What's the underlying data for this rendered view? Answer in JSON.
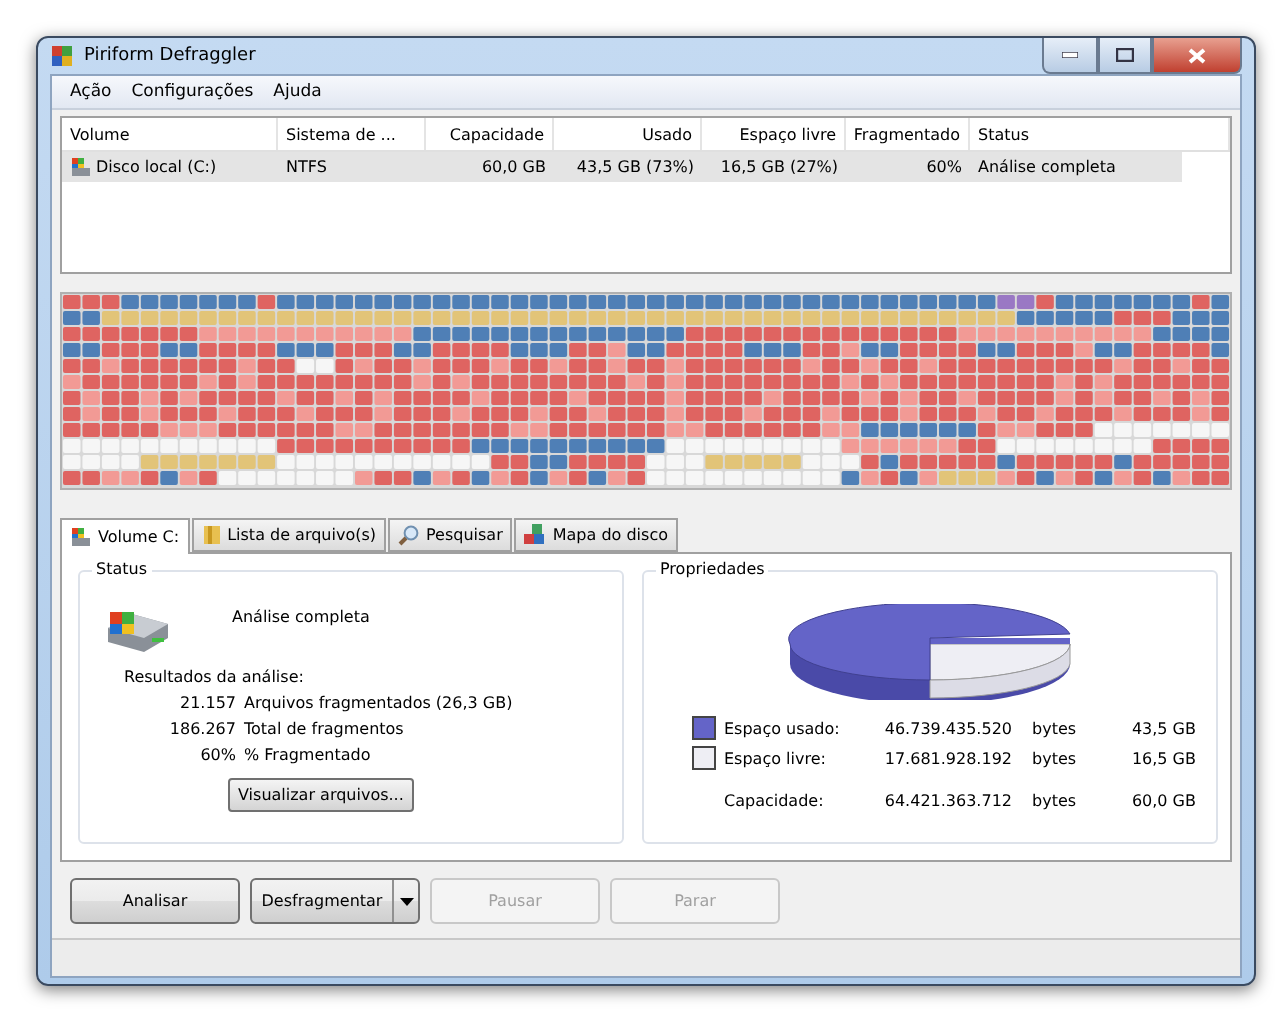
{
  "window": {
    "title": "Piriform Defraggler"
  },
  "menu": [
    "Ação",
    "Configurações",
    "Ajuda"
  ],
  "volumes": {
    "columns": [
      "Volume",
      "Sistema de ...",
      "Capacidade",
      "Usado",
      "Espaço livre",
      "Fragmentado",
      "Status"
    ],
    "rows": [
      {
        "selected": true,
        "cells": [
          "Disco local (C:)",
          "NTFS",
          "60,0 GB",
          "43,5 GB (73%)",
          "16,5 GB (27%)",
          "60%",
          "Análise completa"
        ]
      }
    ]
  },
  "tabs": [
    {
      "label": "Volume C:",
      "selected": true,
      "kind": "drive"
    },
    {
      "label": "Lista de arquivo(s)",
      "selected": false,
      "kind": "folder"
    },
    {
      "label": "Pesquisar",
      "selected": false,
      "kind": "search"
    },
    {
      "label": "Mapa do disco",
      "selected": false,
      "kind": "map"
    }
  ],
  "status": {
    "title": "Status",
    "message": "Análise completa",
    "results_title": "Resultados da análise:",
    "results": [
      {
        "count": "21.157",
        "description": "Arquivos fragmentados (26,3 GB)"
      },
      {
        "count": "186.267",
        "description": "Total de fragmentos"
      },
      {
        "count": "60%",
        "description": "% Fragmentado"
      }
    ],
    "button": "Visualizar arquivos..."
  },
  "properties": {
    "title": "Propriedades",
    "rows": [
      {
        "label": "Espaço usado:",
        "bytes": "46.739.435.520",
        "unit": "bytes",
        "size": "43,5 GB",
        "color": "#6464c8"
      },
      {
        "label": "Espaço livre:",
        "bytes": "17.681.928.192",
        "unit": "bytes",
        "size": "16,5 GB",
        "color": "#eeeef4"
      },
      {
        "label": "Capacidade:",
        "bytes": "64.421.363.712",
        "unit": "bytes",
        "size": "60,0 GB"
      }
    ]
  },
  "buttons": [
    {
      "label": "Analisar",
      "disabled": false,
      "kind": "plain"
    },
    {
      "label": "Desfragmentar",
      "disabled": false,
      "kind": "split"
    },
    {
      "label": "Pausar",
      "disabled": true,
      "kind": "plain"
    },
    {
      "label": "Parar",
      "disabled": true,
      "kind": "plain"
    }
  ]
}
